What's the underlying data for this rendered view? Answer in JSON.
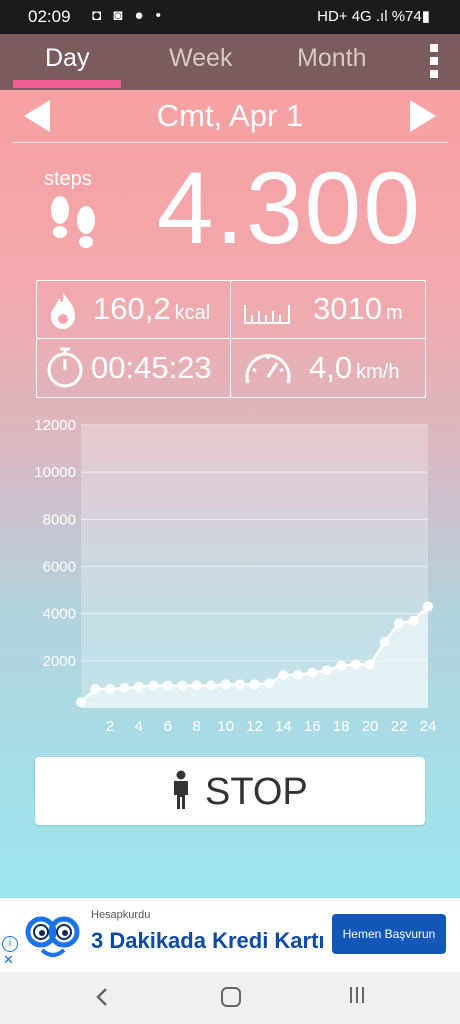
{
  "status": {
    "time": "02:09",
    "left_icons": "◘ ◙ ● •",
    "right_text": "HD+ 4G .ıl %74▮",
    "battery": "%74"
  },
  "tabs": [
    {
      "label": "Day"
    },
    {
      "label": "Week"
    },
    {
      "label": "Month"
    }
  ],
  "date": {
    "label": "Cmt, Apr 1"
  },
  "steps": {
    "label": "steps",
    "value": "4.300"
  },
  "stats": {
    "calories": {
      "value": "160,2",
      "unit": "kcal"
    },
    "distance": {
      "value": "3010",
      "unit": "m"
    },
    "duration": {
      "value": "00:45:23"
    },
    "speed": {
      "value": "4,0",
      "unit": "km/h"
    }
  },
  "chart_data": {
    "type": "area",
    "x": [
      0,
      1,
      2,
      3,
      4,
      5,
      6,
      7,
      8,
      9,
      10,
      11,
      12,
      13,
      14,
      15,
      16,
      17,
      18,
      19,
      20,
      21,
      22,
      23,
      24
    ],
    "series": [
      {
        "values": [
          250,
          800,
          800,
          850,
          900,
          950,
          950,
          950,
          950,
          950,
          1000,
          1000,
          1000,
          1050,
          1400,
          1400,
          1500,
          1600,
          1800,
          1850,
          1850,
          2800,
          3600,
          3700,
          4300
        ]
      }
    ],
    "xticks": [
      "2",
      "4",
      "6",
      "8",
      "10",
      "12",
      "14",
      "16",
      "18",
      "20",
      "22",
      "24"
    ],
    "yticks": [
      "2000",
      "4000",
      "6000",
      "8000",
      "10000",
      "12000"
    ],
    "xlim": [
      0,
      24
    ],
    "ylim": [
      0,
      12000
    ],
    "grid": true,
    "colors": {
      "line": "#ffffff",
      "fill": "rgba(255,255,255,0.55)",
      "plot_bg": "rgba(255,255,255,0.25)"
    }
  },
  "stop_button": {
    "label": "STOP"
  },
  "ad": {
    "brand": "Hesapkurdu",
    "headline": "3 Dakikada Kredi Kartı",
    "cta": "Hemen Başvurun",
    "info": "i",
    "close": "✕"
  },
  "colors": {
    "tab_bg": "#7a5c5e",
    "indicator": "#ef5d93",
    "ad_cta": "#1357b8"
  }
}
